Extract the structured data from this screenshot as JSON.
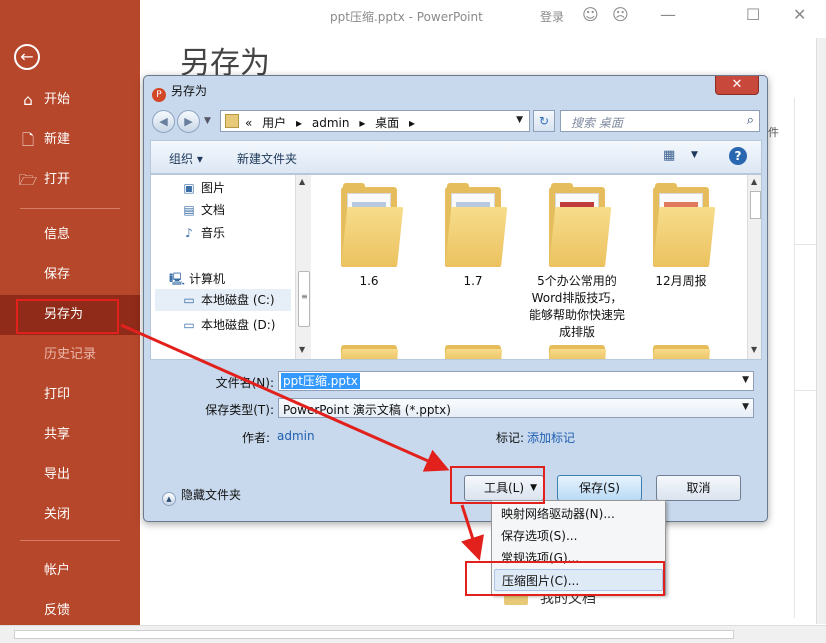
{
  "window": {
    "title": "ppt压缩.pptx - PowerPoint",
    "login": "登录",
    "icons": [
      "smiley-icon",
      "frown-icon",
      "minimize-icon",
      "restore-icon",
      "close-icon"
    ],
    "icon_glyphs": {
      "smile": "☺",
      "frown": "☹",
      "minimize": "—",
      "restore": "☐",
      "close": "✕"
    }
  },
  "backstage": {
    "heading": "另存为",
    "back_icon": "←",
    "primary_items": [
      {
        "label": "开始",
        "icon": "⌂"
      },
      {
        "label": "新建",
        "icon": "🗋"
      },
      {
        "label": "打开",
        "icon": "🗁"
      }
    ],
    "secondary_items": [
      "信息",
      "保存",
      "另存为",
      "历史记录",
      "打印",
      "共享",
      "导出",
      "关闭"
    ],
    "footer_items": [
      "帐户",
      "反馈"
    ],
    "right_partial_text": "件",
    "recent_folder": "我的文档",
    "colors": {
      "sidebar": "#b7472a",
      "selected": "#8f2b18"
    }
  },
  "dialog": {
    "title": "另存为",
    "app_icon": "P",
    "close": "✕",
    "back_glyph": "◀",
    "forward_glyph": "▶",
    "breadcrumb_prefix": "«",
    "breadcrumbs": [
      "用户",
      "admin",
      "桌面"
    ],
    "separator": "▸",
    "dropdown_glyph": "▼",
    "refresh_glyph": "↻",
    "search_placeholder": "搜索 桌面",
    "search_glyph": "⌕",
    "toolbar": {
      "organize": "组织 ▾",
      "new_folder": "新建文件夹",
      "view_glyph": "▦",
      "help": "?"
    },
    "nav_pane": [
      {
        "label": "图片",
        "icon": "▣"
      },
      {
        "label": "文档",
        "icon": "▤"
      },
      {
        "label": "音乐",
        "icon": "♪"
      },
      {
        "label": "计算机",
        "icon": "🖳"
      },
      {
        "label": "本地磁盘 (C:)",
        "icon": "▭"
      },
      {
        "label": "本地磁盘 (D:)",
        "icon": "▭"
      }
    ],
    "nav_scroll_glyphs": {
      "up": "▲",
      "down": "▼",
      "grip": "≡"
    },
    "files": [
      {
        "name": "1.6"
      },
      {
        "name": "1.7"
      },
      {
        "name": "5个办公常用的Word排版技巧，能够帮助你快速完成排版"
      },
      {
        "name": "12月周报"
      }
    ],
    "file_name_label": "文件名(N):",
    "file_name_value": "ppt压缩.pptx",
    "file_type_label": "保存类型(T):",
    "file_type_value": "PowerPoint 演示文稿 (*.pptx)",
    "author_label": "作者:",
    "author_value": "admin",
    "tags_label": "标记:",
    "tags_value": "添加标记",
    "hide_folders": "隐藏文件夹",
    "hide_glyph": "▲",
    "tools_button": "工具(L)",
    "save_button": "保存(S)",
    "cancel_button": "取消"
  },
  "tools_menu": [
    "映射网络驱动器(N)...",
    "保存选项(S)...",
    "常规选项(G)...",
    "压缩图片(C)..."
  ]
}
